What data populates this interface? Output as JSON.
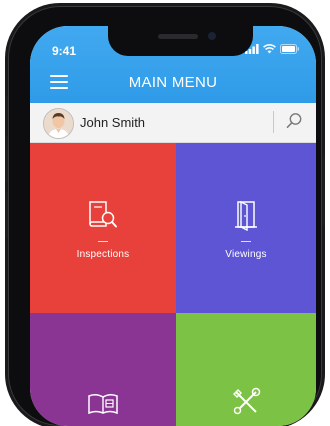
{
  "status_bar": {
    "time": "9:41"
  },
  "header": {
    "title": "MAIN MENU"
  },
  "user": {
    "name": "John Smith"
  },
  "tiles": [
    {
      "label": "Inspections",
      "icon": "book-search-icon",
      "color": "#e8413b"
    },
    {
      "label": "Viewings",
      "icon": "door-icon",
      "color": "#5d55d3"
    },
    {
      "label": "",
      "icon": "open-book-icon",
      "color": "#8a3593"
    },
    {
      "label": "",
      "icon": "tools-icon",
      "color": "#7cc244"
    }
  ],
  "colors": {
    "header": "#2f9be8"
  }
}
